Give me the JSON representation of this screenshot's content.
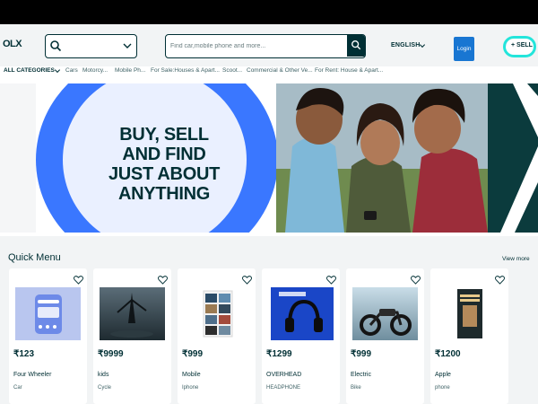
{
  "header": {
    "logo_text": "OLX",
    "search_placeholder": "Find car,mobile phone and more...",
    "language": "ENGLISH",
    "login_label": "Login",
    "sell_label": "SELL"
  },
  "categories": {
    "all_label": "ALL CATEGORIES",
    "items": [
      "Cars",
      "Motorcy...",
      "Mobile Ph...",
      "For Sale:Houses & Apart...",
      "Scoot...",
      "Commercial & Other Ve...",
      "For Rent: House & Apart..."
    ]
  },
  "banner": {
    "headline": "BUY, SELL AND FIND JUST ABOUT ANYTHING"
  },
  "quick_menu": {
    "title": "Quick Menu",
    "view_more": "View more",
    "cards": [
      {
        "price": "₹123",
        "name": "Four Wheeler",
        "sub": "Car"
      },
      {
        "price": "₹9999",
        "name": "kids",
        "sub": "Cycle"
      },
      {
        "price": "₹999",
        "name": "Mobile",
        "sub": "Iphone"
      },
      {
        "price": "₹1299",
        "name": "OVERHEAD",
        "sub": "HEADPHONE"
      },
      {
        "price": "₹999",
        "name": "Electric",
        "sub": "Bike"
      },
      {
        "price": "₹1200",
        "name": "Apple",
        "sub": "phone"
      }
    ]
  },
  "colors": {
    "brand_dark": "#002f34",
    "banner_blue": "#3a77ff",
    "login_blue": "#1976d2",
    "sell_teal": "#23e5db",
    "sell_yellow": "#ffce32"
  }
}
